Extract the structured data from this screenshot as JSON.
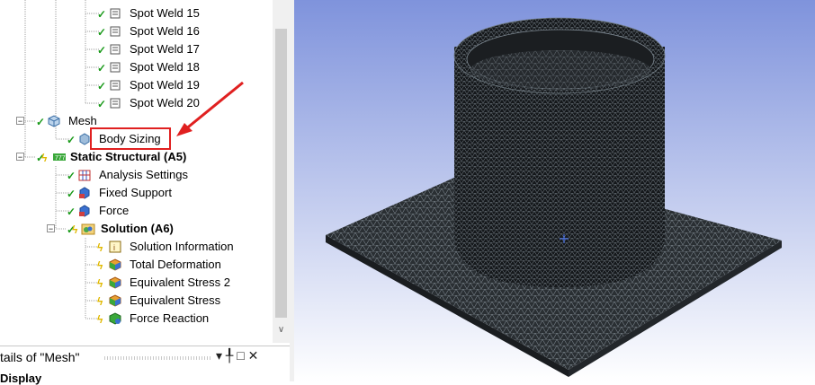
{
  "tree": {
    "spot_welds": [
      "Spot Weld 15",
      "Spot Weld 16",
      "Spot Weld 17",
      "Spot Weld 18",
      "Spot Weld 19",
      "Spot Weld 20"
    ],
    "mesh": "Mesh",
    "body_sizing": "Body Sizing",
    "static_structural": "Static Structural (A5)",
    "analysis_items": [
      "Analysis Settings",
      "Fixed Support",
      "Force"
    ],
    "solution": "Solution (A6)",
    "solution_items": [
      "Solution Information",
      "Total Deformation",
      "Equivalent Stress 2",
      "Equivalent Stress",
      "Force Reaction"
    ]
  },
  "details": {
    "title": "tails of \"Mesh\"",
    "pin": "▾ ╀ □ ✕",
    "display": "Display"
  },
  "colors": {
    "highlight_box": "#e02020",
    "arrow": "#e02020",
    "viewport_top": "#7f93dc",
    "viewport_bottom": "#ffffff"
  },
  "icons": [
    "check-icon",
    "spot-weld-icon",
    "mesh-icon",
    "static-structural-icon",
    "analysis-settings-icon",
    "fixed-support-icon",
    "force-icon",
    "solution-icon",
    "result-icon",
    "collapse-icon"
  ]
}
